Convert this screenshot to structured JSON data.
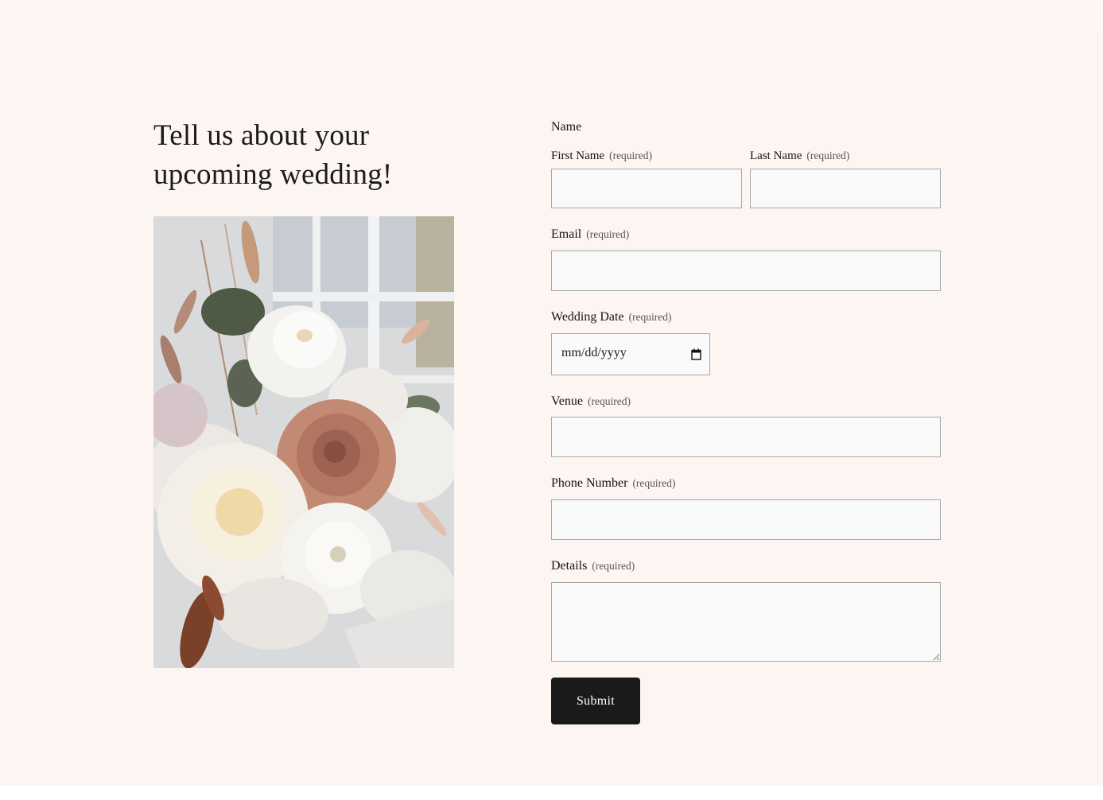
{
  "page": {
    "heading": "Tell us about your upcoming wedding!",
    "background_color": "#fdf5f1"
  },
  "image": {
    "subject": "bridal bouquet of white peonies, garden roses, a dusty-rose rose and dried pampas grass"
  },
  "form": {
    "name_group_label": "Name",
    "required_marker": "(required)",
    "first_name": {
      "label": "First Name",
      "value": "",
      "placeholder": ""
    },
    "last_name": {
      "label": "Last Name",
      "value": "",
      "placeholder": ""
    },
    "email": {
      "label": "Email",
      "value": "",
      "placeholder": ""
    },
    "wedding_date": {
      "label": "Wedding Date",
      "display": "mm/dd/yyyy",
      "icon": "calendar-icon"
    },
    "venue": {
      "label": "Venue",
      "value": "",
      "placeholder": ""
    },
    "phone": {
      "label": "Phone Number",
      "value": "",
      "placeholder": ""
    },
    "details": {
      "label": "Details",
      "value": "",
      "placeholder": ""
    },
    "submit_label": "Submit",
    "submit_color": "#1a1a1a",
    "field_background": "#f9f9f9",
    "field_border": "#a8a8a8"
  }
}
